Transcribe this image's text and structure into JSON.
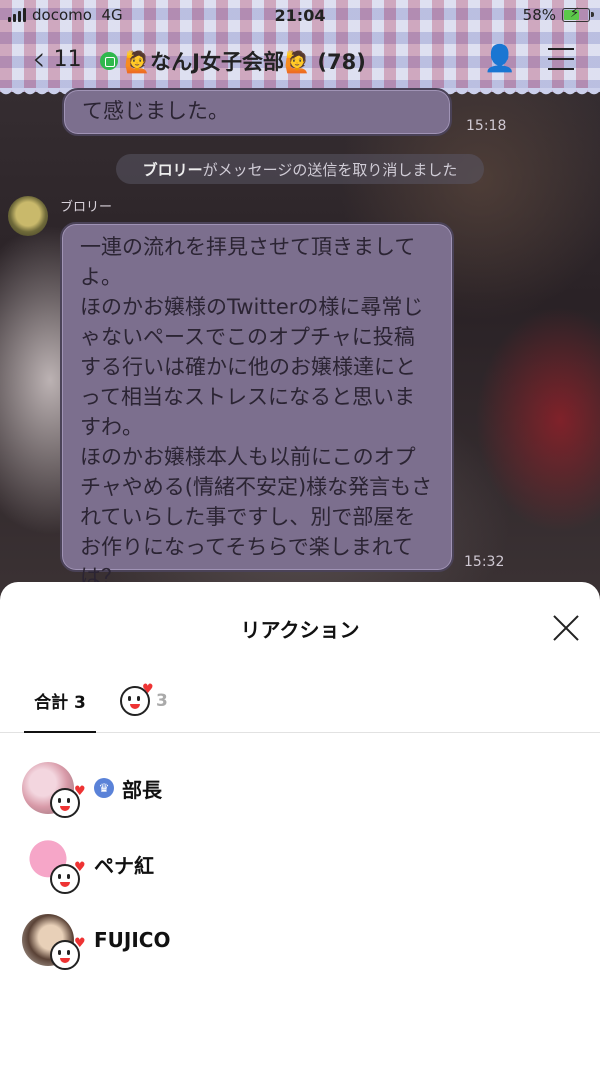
{
  "status": {
    "carrier": "docomo",
    "network": "4G",
    "time": "21:04",
    "battery": "58%"
  },
  "header": {
    "back_count": "11",
    "room_name": "🙋なんJ女子会部🙋 (78)"
  },
  "chat": {
    "bubble1_text": "て感じました。",
    "bubble1_time": "15:18",
    "system_name": "ブロリー",
    "system_text": "がメッセージの送信を取り消しました",
    "sender_name": "ブロリー",
    "bubble2_text": "一連の流れを拝見させて頂きましてよ。\nほのかお嬢様のTwitterの様に尋常じゃないペースでこのオプチャに投稿する行いは確かに他のお嬢様達にとって相当なストレスになると思いますわ。\nほのかお嬢様本人も以前にこのオプチャやめる(情緒不安定)様な発言もされていらした事ですし、別で部屋をお作りになってそちらで楽しまれては？",
    "bubble2_time": "15:32"
  },
  "sheet": {
    "title": "リアクション",
    "tab_total": "合計 3",
    "tab_sticker_count": "3",
    "users": [
      {
        "name": "部長",
        "crown": true
      },
      {
        "name": "ペナ紅",
        "crown": false
      },
      {
        "name": "FUJICO",
        "crown": false
      }
    ]
  }
}
